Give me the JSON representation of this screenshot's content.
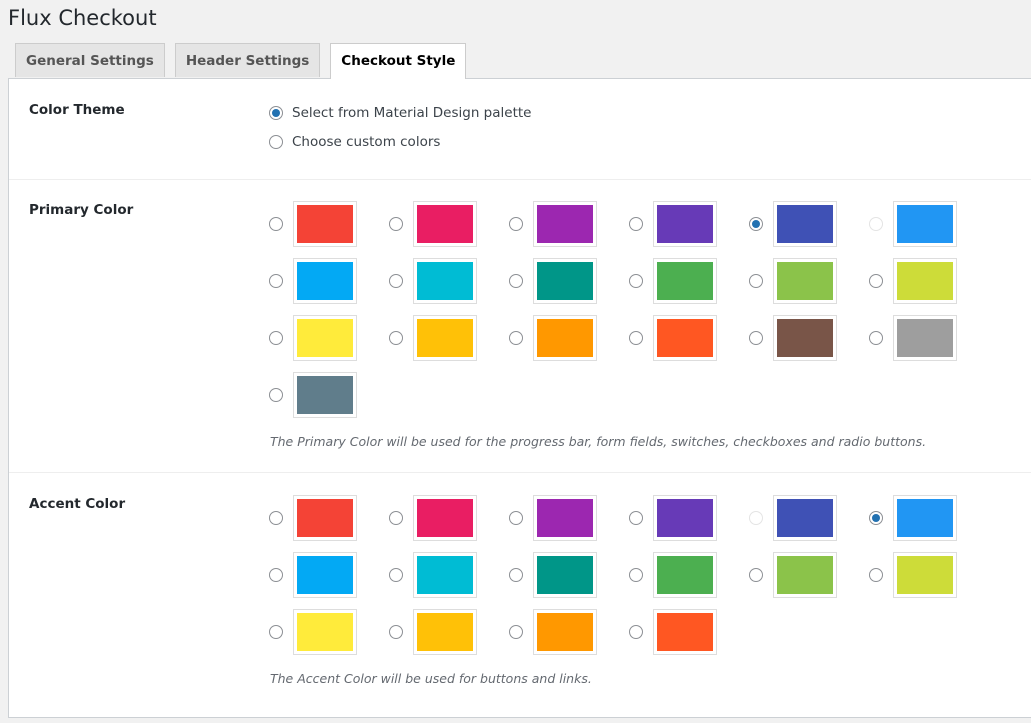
{
  "page": {
    "title": "Flux Checkout"
  },
  "tabs": [
    {
      "label": "General Settings",
      "active": false
    },
    {
      "label": "Header Settings",
      "active": false
    },
    {
      "label": "Checkout Style",
      "active": true
    }
  ],
  "color_theme": {
    "label": "Color Theme",
    "options": [
      {
        "label": "Select from Material Design palette",
        "checked": true
      },
      {
        "label": "Choose custom colors",
        "checked": false
      }
    ]
  },
  "primary_color": {
    "label": "Primary Color",
    "help": "The Primary Color will be used for the progress bar, form fields, switches, checkboxes and radio buttons.",
    "swatches": [
      {
        "color": "#f44336",
        "state": "unchecked"
      },
      {
        "color": "#e91e63",
        "state": "unchecked"
      },
      {
        "color": "#9c27b0",
        "state": "unchecked"
      },
      {
        "color": "#673ab7",
        "state": "unchecked"
      },
      {
        "color": "#3f51b5",
        "state": "checked"
      },
      {
        "color": "#2196f3",
        "state": "disabled"
      },
      {
        "color": "#03a9f4",
        "state": "unchecked"
      },
      {
        "color": "#00bcd4",
        "state": "unchecked"
      },
      {
        "color": "#009688",
        "state": "unchecked"
      },
      {
        "color": "#4caf50",
        "state": "unchecked"
      },
      {
        "color": "#8bc34a",
        "state": "unchecked"
      },
      {
        "color": "#cddc39",
        "state": "unchecked"
      },
      {
        "color": "#ffeb3b",
        "state": "unchecked"
      },
      {
        "color": "#ffc107",
        "state": "unchecked"
      },
      {
        "color": "#ff9800",
        "state": "unchecked"
      },
      {
        "color": "#ff5722",
        "state": "unchecked"
      },
      {
        "color": "#795548",
        "state": "unchecked"
      },
      {
        "color": "#9e9e9e",
        "state": "unchecked"
      },
      {
        "color": "#607d8b",
        "state": "unchecked"
      }
    ]
  },
  "accent_color": {
    "label": "Accent Color",
    "help": "The Accent Color will be used for buttons and links.",
    "swatches": [
      {
        "color": "#f44336",
        "state": "unchecked"
      },
      {
        "color": "#e91e63",
        "state": "unchecked"
      },
      {
        "color": "#9c27b0",
        "state": "unchecked"
      },
      {
        "color": "#673ab7",
        "state": "unchecked"
      },
      {
        "color": "#3f51b5",
        "state": "disabled"
      },
      {
        "color": "#2196f3",
        "state": "checked"
      },
      {
        "color": "#03a9f4",
        "state": "unchecked"
      },
      {
        "color": "#00bcd4",
        "state": "unchecked"
      },
      {
        "color": "#009688",
        "state": "unchecked"
      },
      {
        "color": "#4caf50",
        "state": "unchecked"
      },
      {
        "color": "#8bc34a",
        "state": "unchecked"
      },
      {
        "color": "#cddc39",
        "state": "unchecked"
      },
      {
        "color": "#ffeb3b",
        "state": "unchecked"
      },
      {
        "color": "#ffc107",
        "state": "unchecked"
      },
      {
        "color": "#ff9800",
        "state": "unchecked"
      },
      {
        "color": "#ff5722",
        "state": "unchecked"
      }
    ]
  }
}
